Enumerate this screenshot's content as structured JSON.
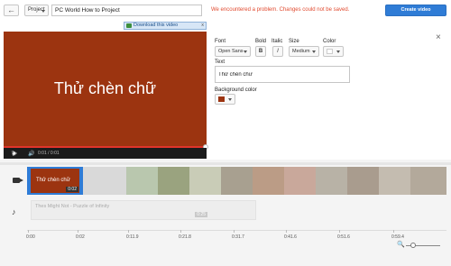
{
  "header": {
    "back_icon": "left-arrow-icon",
    "project_label": "Project",
    "project_title": "PC World How to Project",
    "error_message": "We encountered a problem. Changes could not be saved.",
    "create_label": "Create video"
  },
  "download_bar": {
    "label": "Download this video",
    "close": "x"
  },
  "preview": {
    "caption": "Thử chèn chữ",
    "volume_icon": "volume-icon",
    "time": "0:01 / 0:01",
    "progress": 1.0
  },
  "text_panel": {
    "font_label": "Font",
    "font_value": "Open Sans",
    "bold_label": "Bold",
    "bold_glyph": "B",
    "italic_label": "Italic",
    "italic_glyph": "I",
    "size_label": "Size",
    "size_value": "Medium",
    "color_label": "Color",
    "text_label": "Text",
    "text_value": "Thử chèn chữ",
    "bg_label": "Background color",
    "bg_color": "#9c3410",
    "close": "×"
  },
  "timeline": {
    "clip_label": "Thử chèn chữ",
    "clip_time": "0:02",
    "audio_label": "Thes Might Not - Puzzle of Infinity",
    "audio_time": "0:25",
    "ticks": [
      "0:00",
      "0:02",
      "0:11.9",
      "0:21.8",
      "0:31.7",
      "0:41.6",
      "0:51.6",
      "0:59.4"
    ],
    "zoom_level": 0.15
  },
  "colors": {
    "accent": "#2f7cd6",
    "brand_red": "#9c3410",
    "error": "#e14a2f",
    "progress": "#e0342b"
  }
}
